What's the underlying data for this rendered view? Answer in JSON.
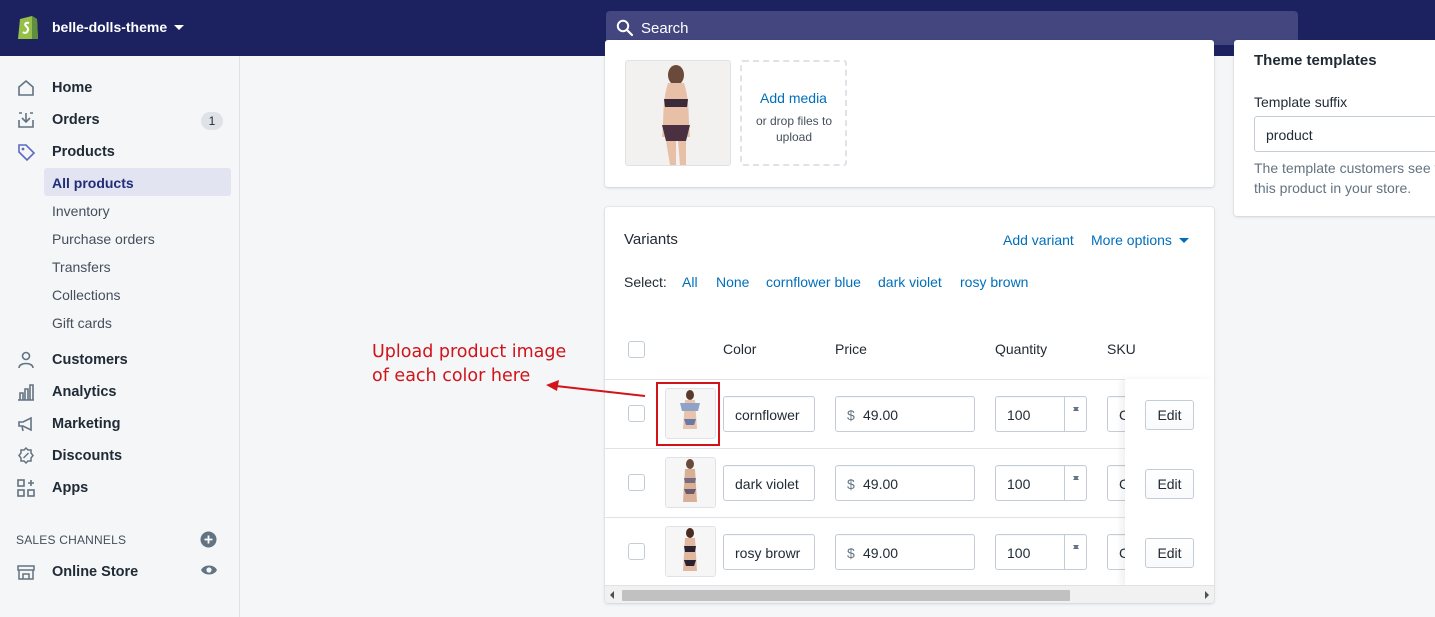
{
  "topbar": {
    "store_name": "belle-dolls-theme",
    "search_placeholder": "Search",
    "bg_color": "#1c2260"
  },
  "sidebar": {
    "items": [
      {
        "label": "Home",
        "icon": "home-icon"
      },
      {
        "label": "Orders",
        "icon": "orders-icon",
        "badge": "1"
      },
      {
        "label": "Products",
        "icon": "tag-icon"
      },
      {
        "label": "Customers",
        "icon": "person-icon"
      },
      {
        "label": "Analytics",
        "icon": "bar-chart-icon"
      },
      {
        "label": "Marketing",
        "icon": "megaphone-icon"
      },
      {
        "label": "Discounts",
        "icon": "discount-icon"
      },
      {
        "label": "Apps",
        "icon": "apps-icon"
      }
    ],
    "product_sub_items": [
      "All products",
      "Inventory",
      "Purchase orders",
      "Transfers",
      "Collections",
      "Gift cards"
    ],
    "active_sub_item": "All products",
    "sales_channels_label": "SALES CHANNELS",
    "online_store_label": "Online Store"
  },
  "media": {
    "add_media_label": "Add media",
    "drop_label": "or drop files to upload"
  },
  "variants": {
    "title": "Variants",
    "add_variant": "Add variant",
    "more_options": "More options",
    "select_label": "Select:",
    "select_options": [
      "All",
      "None",
      "cornflower blue",
      "dark violet",
      "rosy brown"
    ],
    "columns": [
      "Color",
      "Price",
      "Quantity",
      "SKU"
    ],
    "currency": "$",
    "edit_label": "Edit",
    "sku_partial": "C",
    "rows": [
      {
        "color": "cornflower",
        "price": "49.00",
        "quantity": "100"
      },
      {
        "color": "dark violet",
        "price": "49.00",
        "quantity": "100"
      },
      {
        "color": "rosy browr",
        "price": "49.00",
        "quantity": "100"
      }
    ]
  },
  "theme_templates": {
    "title": "Theme templates",
    "suffix_label": "Template suffix",
    "suffix_value": "product",
    "help_line1": "The template customers see v",
    "help_line2": "this product in your store."
  },
  "annotation": {
    "line1": "Upload product image",
    "line2": "of each color here",
    "color": "#d0141a"
  }
}
